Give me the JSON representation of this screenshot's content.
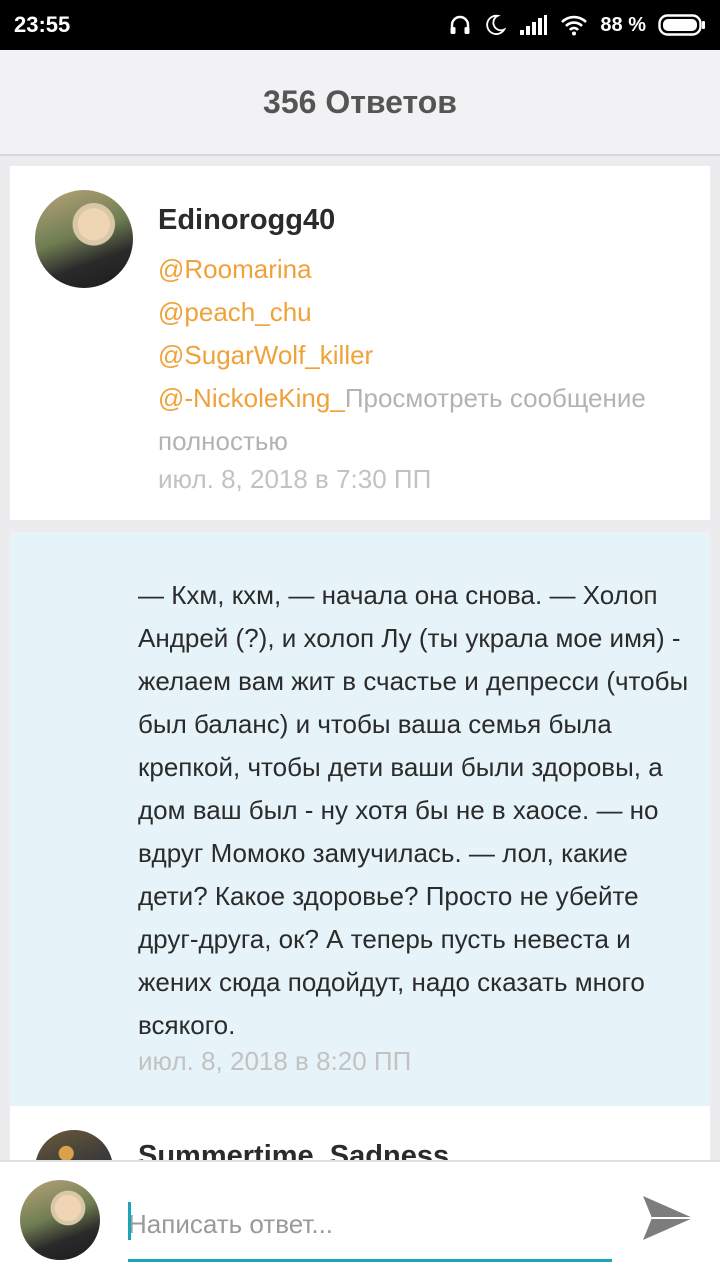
{
  "status_bar": {
    "time": "23:55",
    "battery_percent": "88 %",
    "icons": [
      "headphones-icon",
      "moon-icon",
      "signal-icon",
      "wifi-icon",
      "battery-icon"
    ]
  },
  "header": {
    "title": "356 Ответов"
  },
  "comments": [
    {
      "author": "Edinorogg40",
      "mentions": [
        "@Roomarina",
        "@peach_chu",
        "@SugarWolf_killer",
        "@-NickoleKing_"
      ],
      "view_full": "Просмотреть сообщение полностью",
      "date": "июл. 8, 2018 в 7:30 ПП"
    },
    {
      "text": "— Кхм, кхм, — начала она снова. — Холоп Андрей (?), и холоп Лу (ты украла мое имя) - желаем вам жит в счастье и депресси (чтобы был баланс) и чтобы ваша семья была крепкой, чтобы дети ваши были здоровы, а дом ваш был - ну хотя бы не в хаосе.  — но вдруг Момоко замучилась. — лол, какие дети? Какое здоровье? Просто не убейте друг-друга, ок? А теперь пусть невеста и жених сюда подойдут, надо сказать много всякого.",
      "date": "июл. 8, 2018 в 8:20 ПП"
    },
    {
      "author": "Summertime_Sadness"
    }
  ],
  "reply": {
    "placeholder": "Написать ответ...",
    "send_icon": "send-icon"
  },
  "colors": {
    "mention": "#f0a23a",
    "highlight_bg": "#e6f4f9",
    "accent": "#1aa6b7"
  }
}
